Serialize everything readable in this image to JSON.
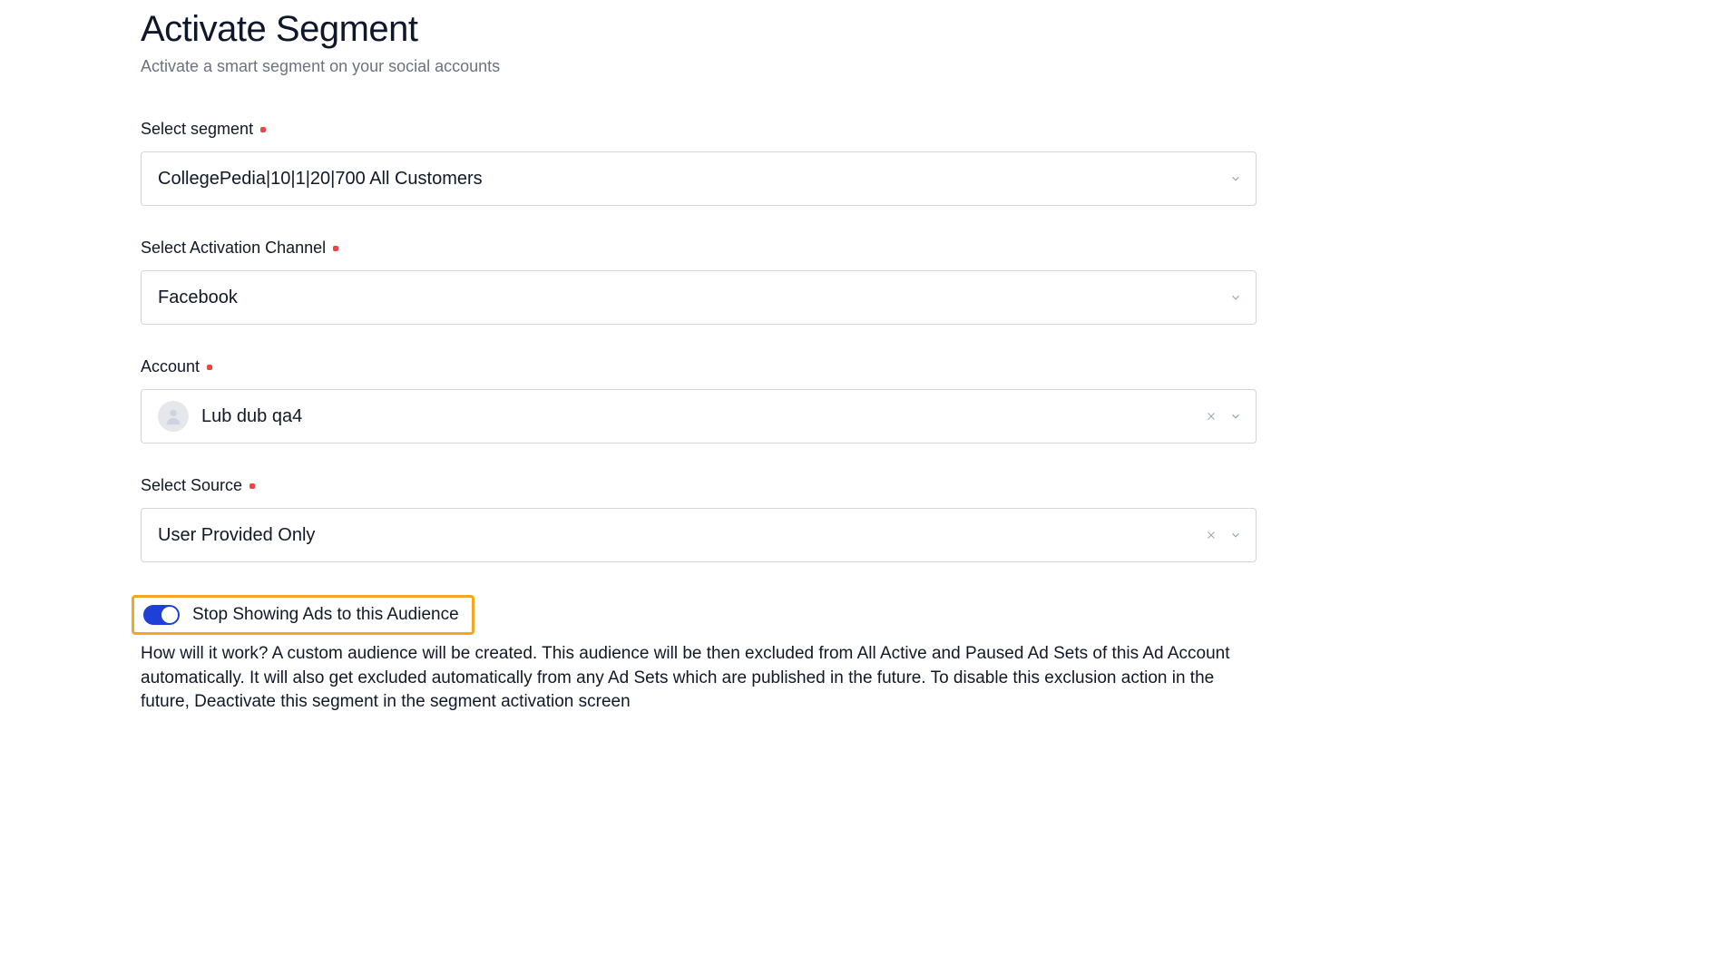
{
  "page": {
    "title": "Activate Segment",
    "subtitle": "Activate a smart segment on your social accounts"
  },
  "fields": {
    "segment": {
      "label": "Select segment",
      "value": "CollegePedia|10|1|20|700 All Customers"
    },
    "channel": {
      "label": "Select Activation Channel",
      "value": "Facebook"
    },
    "account": {
      "label": "Account",
      "value": "Lub dub qa4"
    },
    "source": {
      "label": "Select Source",
      "value": "User Provided Only"
    }
  },
  "toggle": {
    "label": "Stop Showing Ads to this Audience",
    "on": true
  },
  "description": "How will it work? A custom audience will be created. This audience will be then excluded from All Active and Paused Ad Sets of this Ad Account automatically. It will also get excluded automatically from any Ad Sets which are published in the future. To disable this exclusion action in the future, Deactivate this segment in the segment activation screen"
}
